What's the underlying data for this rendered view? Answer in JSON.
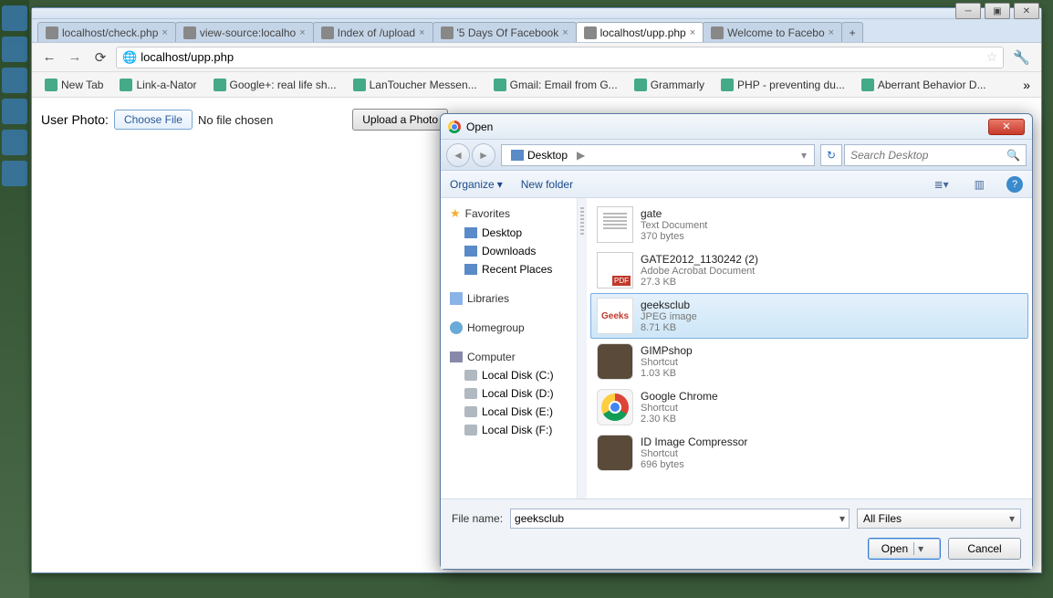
{
  "window": {
    "controls": {
      "min": "─",
      "max": "▣",
      "close": "✕"
    }
  },
  "tabs": [
    {
      "title": "localhost/check.php"
    },
    {
      "title": "view-source:localho"
    },
    {
      "title": "Index of /upload"
    },
    {
      "title": "'5 Days Of Facebook"
    },
    {
      "title": "localhost/upp.php",
      "active": true
    },
    {
      "title": "Welcome to Facebo"
    }
  ],
  "toolbar": {
    "back": "←",
    "forward": "→",
    "reload": "⟳",
    "url": "localhost/upp.php",
    "star": "☆",
    "wrench": "🔧"
  },
  "bookmarks": [
    {
      "label": "New Tab"
    },
    {
      "label": "Link-a-Nator"
    },
    {
      "label": "Google+: real life sh..."
    },
    {
      "label": "LanToucher Messen..."
    },
    {
      "label": "Gmail: Email from G..."
    },
    {
      "label": "Grammarly"
    },
    {
      "label": "PHP - preventing du..."
    },
    {
      "label": "Aberrant Behavior D..."
    }
  ],
  "bookmarks_more": "»",
  "page": {
    "label": "User Photo:",
    "choose": "Choose File",
    "nofile": "No file chosen",
    "upload": "Upload a Photo"
  },
  "dialog": {
    "title": "Open",
    "breadcrumb": "Desktop",
    "breadcrumb_chev": "▶",
    "breadcrumb_drop": "▾",
    "refresh": "↻",
    "search_placeholder": "Search Desktop",
    "search_icon": "🔍",
    "toolbar": {
      "organize": "Organize",
      "organize_chev": "▾",
      "newfolder": "New folder",
      "view": "≣▾",
      "preview": "▥",
      "help": "?"
    },
    "nav": {
      "favorites": "Favorites",
      "fav_items": [
        "Desktop",
        "Downloads",
        "Recent Places"
      ],
      "libraries": "Libraries",
      "homegroup": "Homegroup",
      "computer": "Computer",
      "drives": [
        "Local Disk (C:)",
        "Local Disk (D:)",
        "Local Disk (E:)",
        "Local Disk (F:)"
      ]
    },
    "files": [
      {
        "name": "gate",
        "type": "Text Document",
        "size": "370 bytes",
        "kind": "txt"
      },
      {
        "name": "GATE2012_1130242 (2)",
        "type": "Adobe Acrobat Document",
        "size": "27.3 KB",
        "kind": "pdf"
      },
      {
        "name": "geeksclub",
        "type": "JPEG image",
        "size": "8.71 KB",
        "kind": "jpg",
        "selected": true,
        "thumb": "Geeks"
      },
      {
        "name": "GIMPshop",
        "type": "Shortcut",
        "size": "1.03 KB",
        "kind": "app"
      },
      {
        "name": "Google Chrome",
        "type": "Shortcut",
        "size": "2.30 KB",
        "kind": "chrome"
      },
      {
        "name": "ID Image Compressor",
        "type": "Shortcut",
        "size": "696 bytes",
        "kind": "app"
      }
    ],
    "footer": {
      "filename_label": "File name:",
      "filename_value": "geeksclub",
      "filter": "All Files",
      "open": "Open",
      "open_split": "▾",
      "cancel": "Cancel"
    }
  }
}
